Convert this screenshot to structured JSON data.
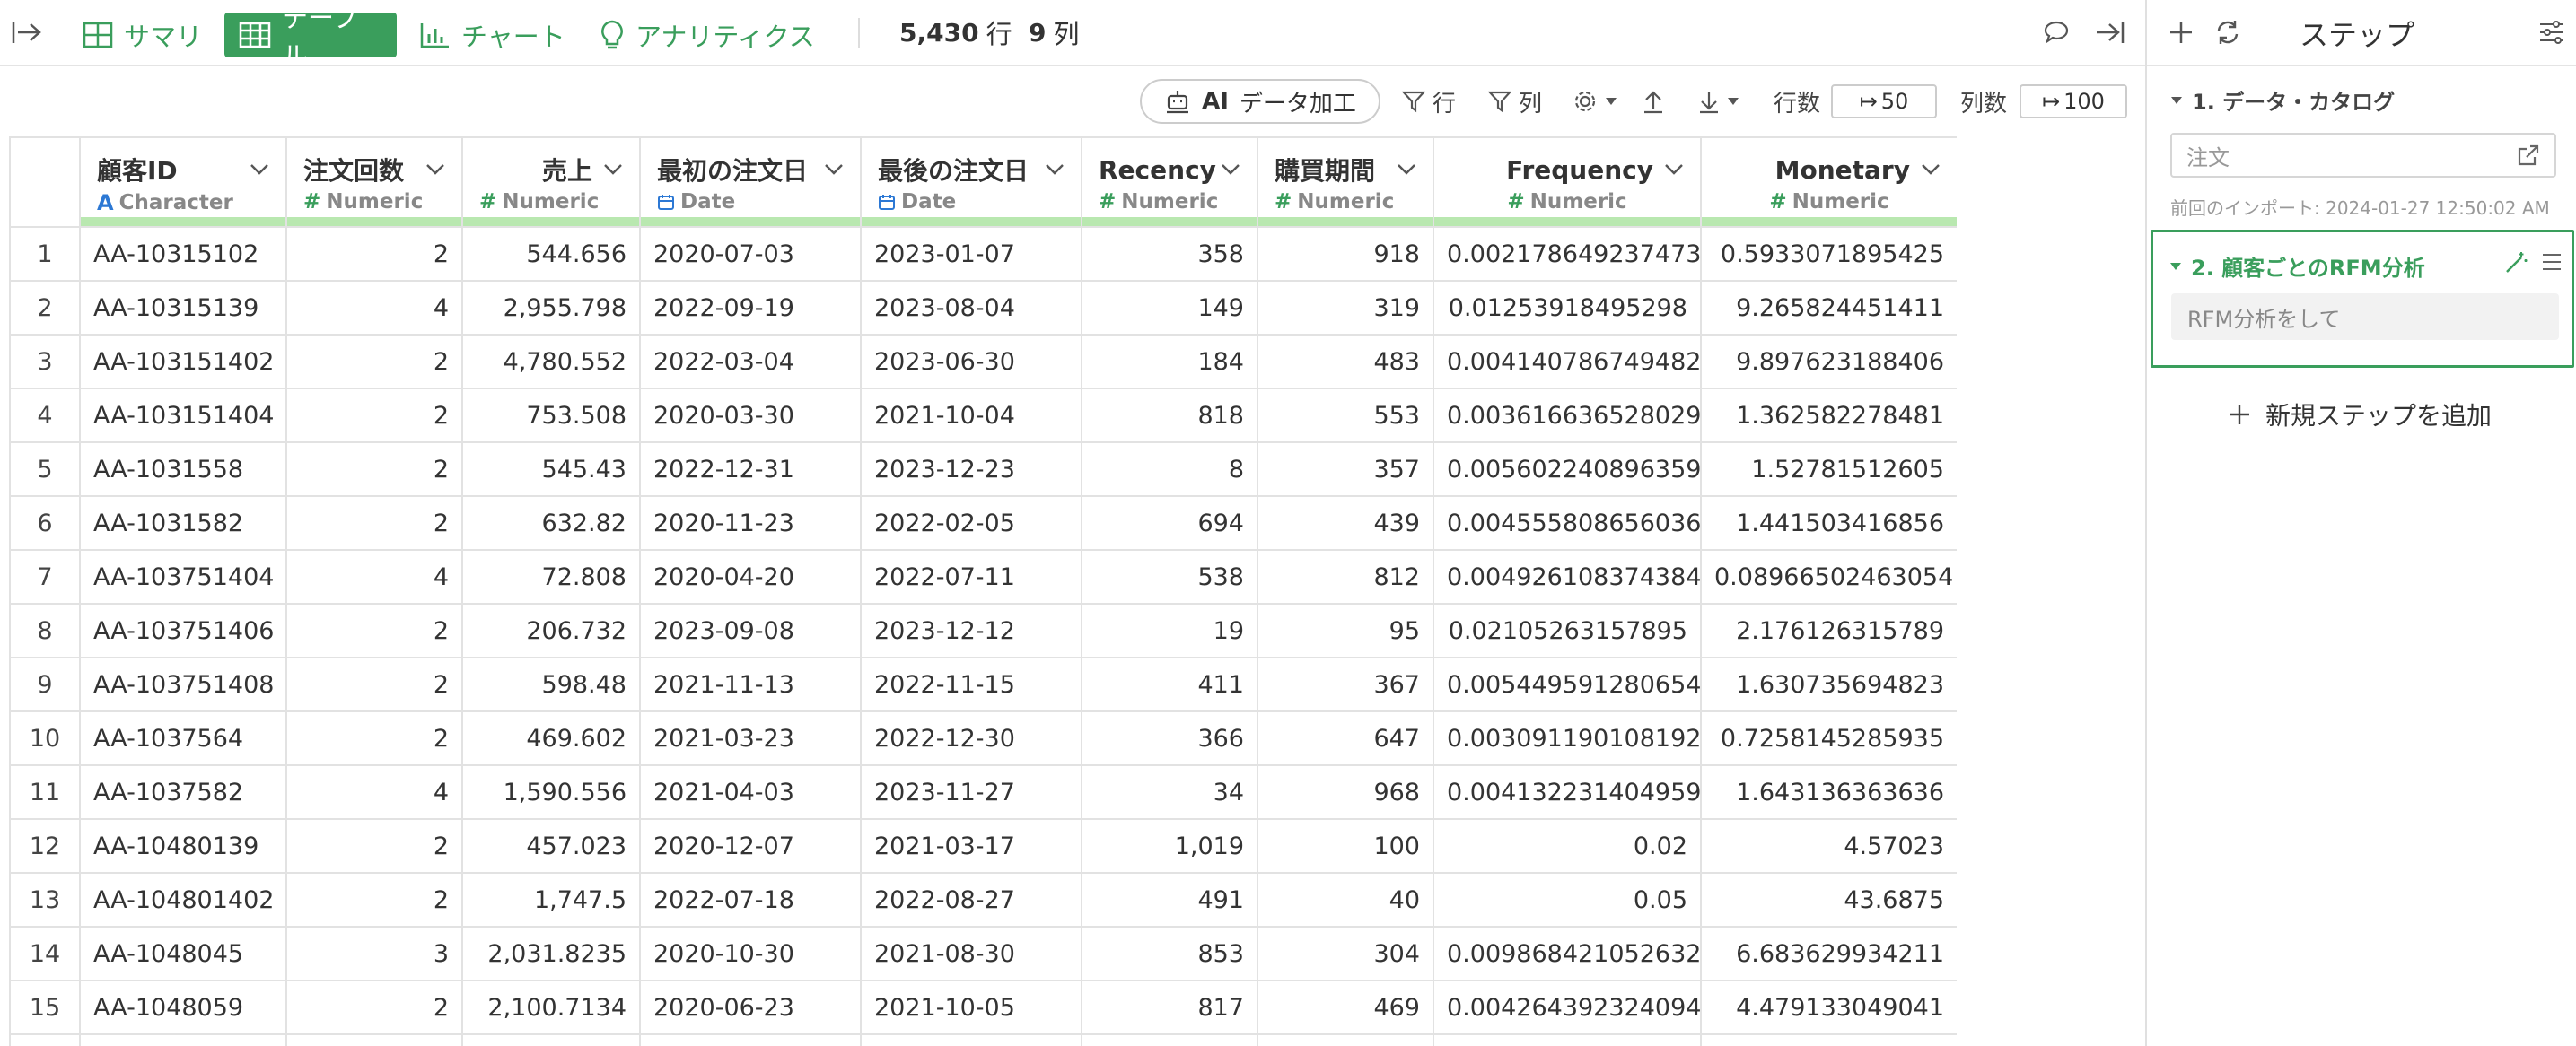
{
  "toolbar": {
    "tabs": [
      {
        "label": "サマリ",
        "icon": "grid-icon"
      },
      {
        "label": "テーブル",
        "icon": "table-icon",
        "active": true
      },
      {
        "label": "チャート",
        "icon": "bar-chart-icon"
      },
      {
        "label": "アナリティクス",
        "icon": "lightbulb-icon"
      }
    ],
    "row_count": "5,430",
    "row_unit": "行",
    "col_count": "9",
    "col_unit": "列"
  },
  "subbar": {
    "ai_label_bold": "AI",
    "ai_label": "データ加工",
    "filter_rows": "行",
    "filter_cols": "列",
    "rows_label": "行数",
    "rows_value": "50",
    "cols_label": "列数",
    "cols_value": "100"
  },
  "table": {
    "columns": [
      {
        "name": "顧客ID",
        "type": "Character"
      },
      {
        "name": "注文回数",
        "type": "Numeric"
      },
      {
        "name": "売上",
        "type": "Numeric"
      },
      {
        "name": "最初の注文日",
        "type": "Date"
      },
      {
        "name": "最後の注文日",
        "type": "Date"
      },
      {
        "name": "Recency",
        "type": "Numeric"
      },
      {
        "name": "購買期間",
        "type": "Numeric"
      },
      {
        "name": "Frequency",
        "type": "Numeric"
      },
      {
        "name": "Monetary",
        "type": "Numeric"
      }
    ],
    "rows": [
      [
        "1",
        "AA-10315102",
        "2",
        "544.656",
        "2020-07-03",
        "2023-01-07",
        "358",
        "918",
        "0.002178649237473",
        "0.5933071895425"
      ],
      [
        "2",
        "AA-10315139",
        "4",
        "2,955.798",
        "2022-09-19",
        "2023-08-04",
        "149",
        "319",
        "0.01253918495298",
        "9.265824451411"
      ],
      [
        "3",
        "AA-103151402",
        "2",
        "4,780.552",
        "2022-03-04",
        "2023-06-30",
        "184",
        "483",
        "0.004140786749482",
        "9.897623188406"
      ],
      [
        "4",
        "AA-103151404",
        "2",
        "753.508",
        "2020-03-30",
        "2021-10-04",
        "818",
        "553",
        "0.003616636528029",
        "1.362582278481"
      ],
      [
        "5",
        "AA-1031558",
        "2",
        "545.43",
        "2022-12-31",
        "2023-12-23",
        "8",
        "357",
        "0.005602240896359",
        "1.52781512605"
      ],
      [
        "6",
        "AA-1031582",
        "2",
        "632.82",
        "2020-11-23",
        "2022-02-05",
        "694",
        "439",
        "0.004555808656036",
        "1.441503416856"
      ],
      [
        "7",
        "AA-103751404",
        "4",
        "72.808",
        "2020-04-20",
        "2022-07-11",
        "538",
        "812",
        "0.004926108374384",
        "0.08966502463054"
      ],
      [
        "8",
        "AA-103751406",
        "2",
        "206.732",
        "2023-09-08",
        "2023-12-12",
        "19",
        "95",
        "0.02105263157895",
        "2.176126315789"
      ],
      [
        "9",
        "AA-103751408",
        "2",
        "598.48",
        "2021-11-13",
        "2022-11-15",
        "411",
        "367",
        "0.005449591280654",
        "1.630735694823"
      ],
      [
        "10",
        "AA-1037564",
        "2",
        "469.602",
        "2021-03-23",
        "2022-12-30",
        "366",
        "647",
        "0.003091190108192",
        "0.7258145285935"
      ],
      [
        "11",
        "AA-1037582",
        "4",
        "1,590.556",
        "2021-04-03",
        "2023-11-27",
        "34",
        "968",
        "0.004132231404959",
        "1.643136363636"
      ],
      [
        "12",
        "AA-10480139",
        "2",
        "457.023",
        "2020-12-07",
        "2021-03-17",
        "1,019",
        "100",
        "0.02",
        "4.57023"
      ],
      [
        "13",
        "AA-104801402",
        "2",
        "1,747.5",
        "2022-07-18",
        "2022-08-27",
        "491",
        "40",
        "0.05",
        "43.6875"
      ],
      [
        "14",
        "AA-1048045",
        "3",
        "2,031.8235",
        "2020-10-30",
        "2021-08-30",
        "853",
        "304",
        "0.009868421052632",
        "6.683629934211"
      ],
      [
        "15",
        "AA-1048059",
        "2",
        "2,100.7134",
        "2020-06-23",
        "2021-10-05",
        "817",
        "469",
        "0.004264392324094",
        "4.479133049041"
      ],
      [
        "",
        "",
        "",
        "",
        "",
        "",
        "",
        "",
        "",
        ""
      ]
    ]
  },
  "panel": {
    "title": "ステップ",
    "step1_title": "1. データ・カタログ",
    "step1_input": "注文",
    "step1_note": "前回のインポート: 2024-01-27 12:50:02 AM",
    "step2_title": "2. 顧客ごとのRFM分析",
    "step2_desc": "RFM分析をして",
    "add_step": "新規ステップを追加"
  },
  "colors": {
    "accent": "#3a9e5c",
    "header_underline": "#b9e8b0",
    "character_type": "#2c78d4"
  }
}
